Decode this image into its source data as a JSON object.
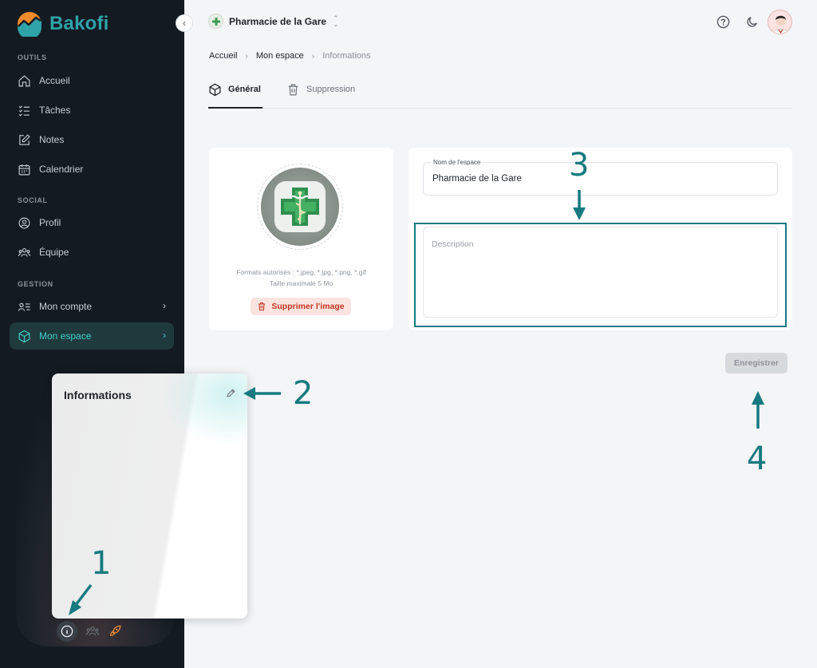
{
  "sidebar": {
    "brand": "Bakofi",
    "sections": {
      "outils": "OUTILS",
      "social": "SOCIAL",
      "gestion": "GESTION"
    },
    "items": {
      "accueil": "Accueil",
      "taches": "Tâches",
      "notes": "Notes",
      "calendrier": "Calendrier",
      "profil": "Profil",
      "equipe": "Équipe",
      "mon_compte": "Mon compte",
      "mon_espace": "Mon espace"
    },
    "collapse_icon": "chevron-left-icon"
  },
  "info_popup": {
    "title": "Informations",
    "edit_icon": "pencil-icon"
  },
  "header": {
    "workspace_name": "Pharmacie de la Gare",
    "icons": [
      "help-circle-icon",
      "moon-icon",
      "user-avatar"
    ]
  },
  "breadcrumb": {
    "items": [
      "Accueil",
      "Mon espace"
    ],
    "current": "Informations"
  },
  "tabs": {
    "general": "Général",
    "suppression": "Suppression",
    "active": "Général"
  },
  "image_card": {
    "formats": "Formats autorisés : *.jpeg, *.jpg, *.png, *.gif",
    "max_size": "Taille maximale 5 Mo",
    "delete_label": "Supprimer l'image"
  },
  "form": {
    "name_label": "Nom de l'espace",
    "name_value": "Pharmacie de la Gare",
    "description_placeholder": "Description"
  },
  "actions": {
    "save_label": "Enregistrer"
  },
  "annotations": {
    "one": "1",
    "two": "2",
    "three": "3",
    "four": "4"
  },
  "colors": {
    "sidebar_bg": "#141a22",
    "accent": "#2ea3a8",
    "active_text": "#3fd0cc",
    "annotation": "#167a80",
    "danger": "#c4361f"
  }
}
